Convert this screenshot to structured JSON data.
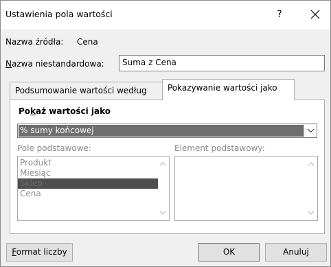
{
  "dialog": {
    "title": "Ustawienia pola wartości",
    "help_label": "?",
    "source_label": "Nazwa źródła:",
    "source_value": "Cena",
    "custom_name_label_u": "N",
    "custom_name_label_rest": "azwa niestandardowa:",
    "custom_name_value": "Suma z Cena"
  },
  "tabs": [
    {
      "label": "Podsumowanie wartości według"
    },
    {
      "label": "Pokazywanie wartości jako"
    }
  ],
  "panel": {
    "heading_pre": "Po",
    "heading_u": "k",
    "heading_post": "aż wartości jako",
    "show_as_value": "% sumy końcowej",
    "base_field_label": "Pole podstawowe:",
    "base_item_label": "Element podstawowy:",
    "base_fields": [
      "Produkt",
      "Miesiąc",
      "Sklep",
      "Cena"
    ]
  },
  "buttons": {
    "number_format_u": "F",
    "number_format_rest": "ormat liczby",
    "ok": "OK",
    "cancel": "Anuluj"
  }
}
